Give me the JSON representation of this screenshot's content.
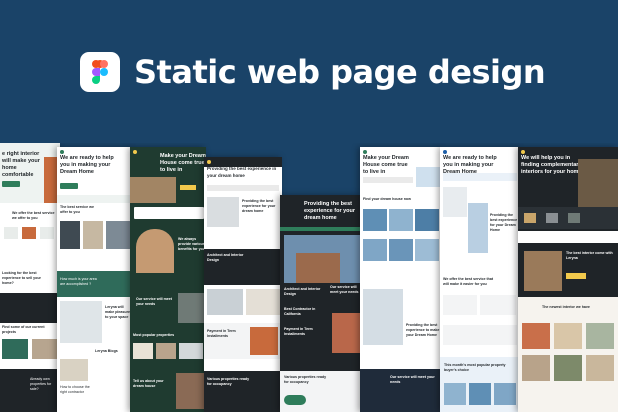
{
  "header": {
    "title": "Static web page design",
    "logo_icon": "figma-logo-icon"
  },
  "colors": {
    "background": "#1a4368",
    "title": "#ffffff",
    "accent_green": "#2f7d5b",
    "accent_yellow": "#f2c94c",
    "dark_card": "#1f2428"
  },
  "screens": [
    {
      "title": "e right interior will make your home comfortable",
      "texts": [
        "We offer the best service we offer to you",
        "Looking for the best experience to sell your home?",
        "Find some of our current projects",
        "Already own properties for sale?"
      ]
    },
    {
      "title": "We are ready to help you in making your Dream Home",
      "texts": [
        "The best service we offer to you",
        "How much is your area are accomplished ?",
        "Leryna will make pleasure to your space",
        "Leryna Blogs",
        "How to choose the right contractor"
      ]
    },
    {
      "title": "Make your Dream House come true to live in",
      "texts": [
        "We always provide various benefits for you",
        "Our service will meet your needs",
        "Most popular properties",
        "Tell us about your dream house"
      ]
    },
    {
      "title": "Providing the best experience in your dream home",
      "texts": [
        "Providing the best experience for your dream home",
        "Architect and Interior Design",
        "Best Contractor in California",
        "Payment in Term Installments",
        "Our service will meet your needs",
        "Various properties ready for occupancy"
      ]
    },
    {
      "title": "Make your Dream House come true to live in",
      "texts": [
        "Find your dream house now",
        "Providing the best experience to make your Dream Home",
        "Our service will meet your needs"
      ]
    },
    {
      "title": "We are ready to help you in making your Dream Home",
      "texts": [
        "We offer the best service that will make it easier for you",
        "This month's most popular property buyer's choice",
        "Providing the best experience for your Dream Home"
      ]
    },
    {
      "title": "We will help you in finding complementary interiors for your home",
      "texts": [
        "The best interior come with Leryna",
        "The newest interior we have"
      ]
    }
  ]
}
